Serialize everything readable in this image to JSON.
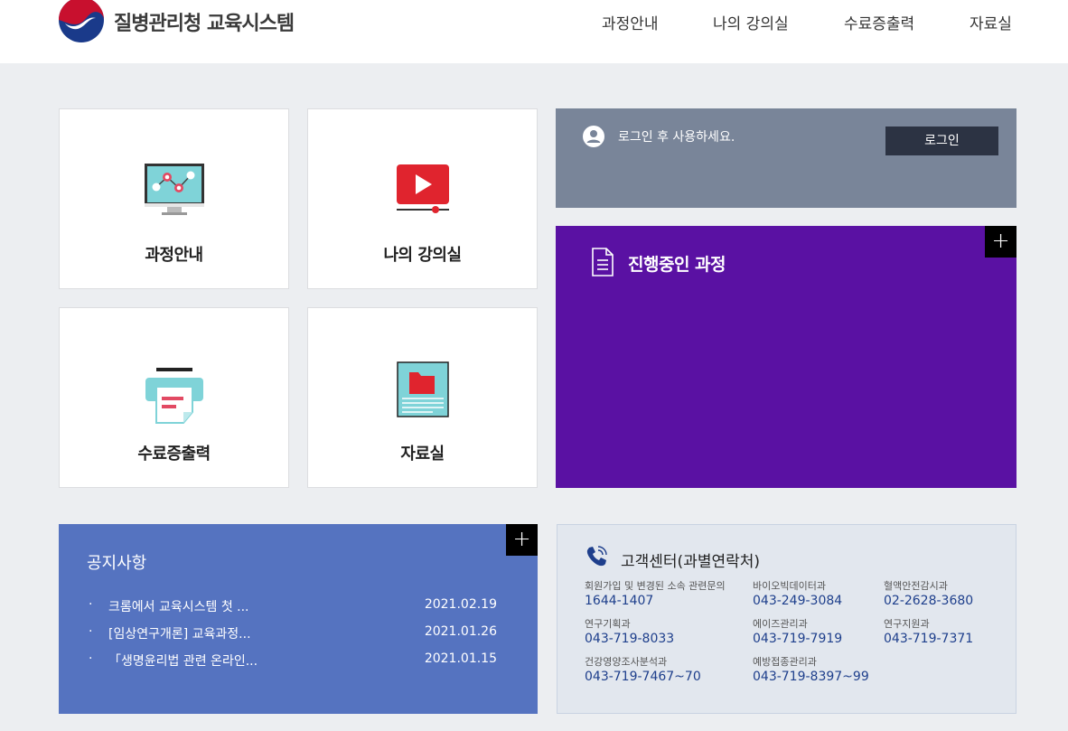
{
  "header": {
    "site_title": "질병관리청 교육시스템",
    "nav": [
      "과정안내",
      "나의 강의실",
      "수료증출력",
      "자료실"
    ]
  },
  "tiles": [
    {
      "label": "과정안내",
      "icon": "monitor-chart-icon"
    },
    {
      "label": "나의 강의실",
      "icon": "video-play-icon"
    },
    {
      "label": "수료증출력",
      "icon": "printer-icon"
    },
    {
      "label": "자료실",
      "icon": "folder-document-icon"
    }
  ],
  "login": {
    "message": "로그인 후 사용하세요.",
    "button": "로그인"
  },
  "in_progress": {
    "title": "진행중인 과정",
    "plus": "+"
  },
  "notice": {
    "title": "공지사항",
    "plus": "+",
    "bullet": "·",
    "items": [
      {
        "text": "크롬에서 교육시스템 첫 ...",
        "date": "2021.02.19"
      },
      {
        "text": "[임상연구개론] 교육과정...",
        "date": "2021.01.26"
      },
      {
        "text": "「생명윤리법 관련 온라인...",
        "date": "2021.01.15"
      }
    ]
  },
  "customer_center": {
    "title": "고객센터(과별연락처)",
    "contacts": [
      {
        "label": "회원가입 및 변경된 소속 관련문의",
        "phone": "1644-1407"
      },
      {
        "label": "바이오빅데이터과",
        "phone": "043-249-3084"
      },
      {
        "label": "혈액안전감시과",
        "phone": "02-2628-3680"
      },
      {
        "label": "연구기획과",
        "phone": "043-719-8033"
      },
      {
        "label": "에이즈관리과",
        "phone": "043-719-7919"
      },
      {
        "label": "연구지원과",
        "phone": "043-719-7371"
      },
      {
        "label": "건강영양조사분석과",
        "phone": "043-719-7467~70"
      },
      {
        "label": "예방접종관리과",
        "phone": "043-719-8397~99"
      }
    ]
  },
  "colors": {
    "login_bg": "#798599",
    "progress_bg": "#5a11a3",
    "notice_bg": "#5573c0",
    "customer_bg": "#e2e7ee",
    "page_bg": "#eceef1"
  }
}
